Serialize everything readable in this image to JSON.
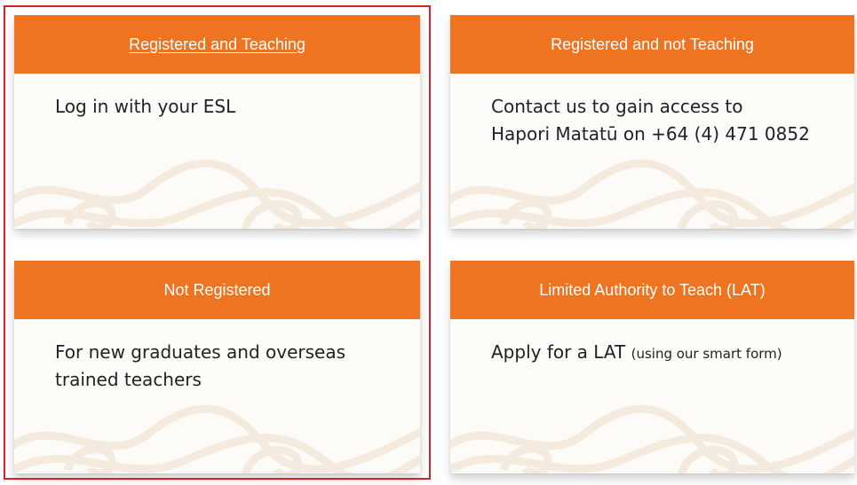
{
  "colors": {
    "header_bg": "#ef7422",
    "header_text": "#ffffff",
    "card_bg": "#fdfbf8",
    "body_text": "#222222",
    "selection_border": "#e02020"
  },
  "cards": {
    "registered_teaching": {
      "header": "Registered and Teaching",
      "body": "Log in with your ESL"
    },
    "registered_not_teaching": {
      "header": "Registered and not Teaching",
      "body_line1": "Contact us to gain access to",
      "body_line2": "Hapori Matatū on +64 (4) 471 0852"
    },
    "not_registered": {
      "header": "Not Registered",
      "body_line1": "For new graduates and overseas",
      "body_line2": "trained teachers"
    },
    "lat": {
      "header": "Limited Authority to Teach (LAT)",
      "body_main": "Apply for a LAT",
      "body_small": "(using our smart form)"
    }
  }
}
